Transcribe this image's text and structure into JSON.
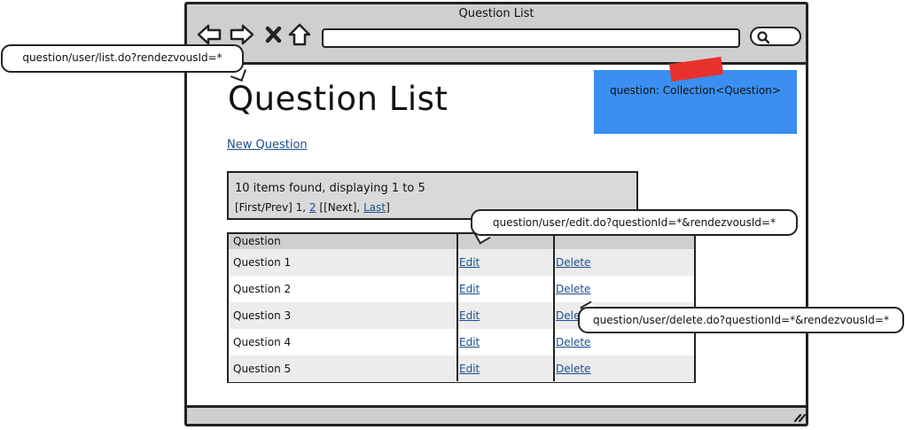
{
  "window": {
    "title": "Question List"
  },
  "page": {
    "heading": "Question List",
    "new_link": "New Question",
    "model_note": "question: Collection<Question>"
  },
  "pager": {
    "count_text": "10 items found, displaying 1 to 5",
    "links": {
      "first_prev": "[First/Prev]",
      "page1": "1,",
      "page2": "2",
      "next": "[[Next],",
      "last": "Last",
      "close": "]"
    }
  },
  "table": {
    "header": "Question",
    "rows": [
      {
        "question": "Question 1",
        "edit": "Edit",
        "delete": "Delete"
      },
      {
        "question": "Question 2",
        "edit": "Edit",
        "delete": "Delete"
      },
      {
        "question": "Question 3",
        "edit": "Edit",
        "delete": "Delete"
      },
      {
        "question": "Question 4",
        "edit": "Edit",
        "delete": "Delete"
      },
      {
        "question": "Question 5",
        "edit": "Edit",
        "delete": "Delete"
      }
    ]
  },
  "callouts": {
    "list_url": "question/user/list.do?rendezvousId=*",
    "edit_url": "question/user/edit.do?questionId=*&rendezvousId=*",
    "delete_url": "question/user/delete.do?questionId=*&rendezvousId=*"
  },
  "icons": {
    "back": "arrow-left-icon",
    "forward": "arrow-right-icon",
    "stop": "close-icon",
    "home": "home-icon",
    "search": "search-icon",
    "resize": "resize-grip-icon"
  },
  "colors": {
    "link": "#1a4f8f",
    "sticky": "#3b8ff0",
    "tape": "#e8312c",
    "chrome": "#cfcfcf"
  }
}
